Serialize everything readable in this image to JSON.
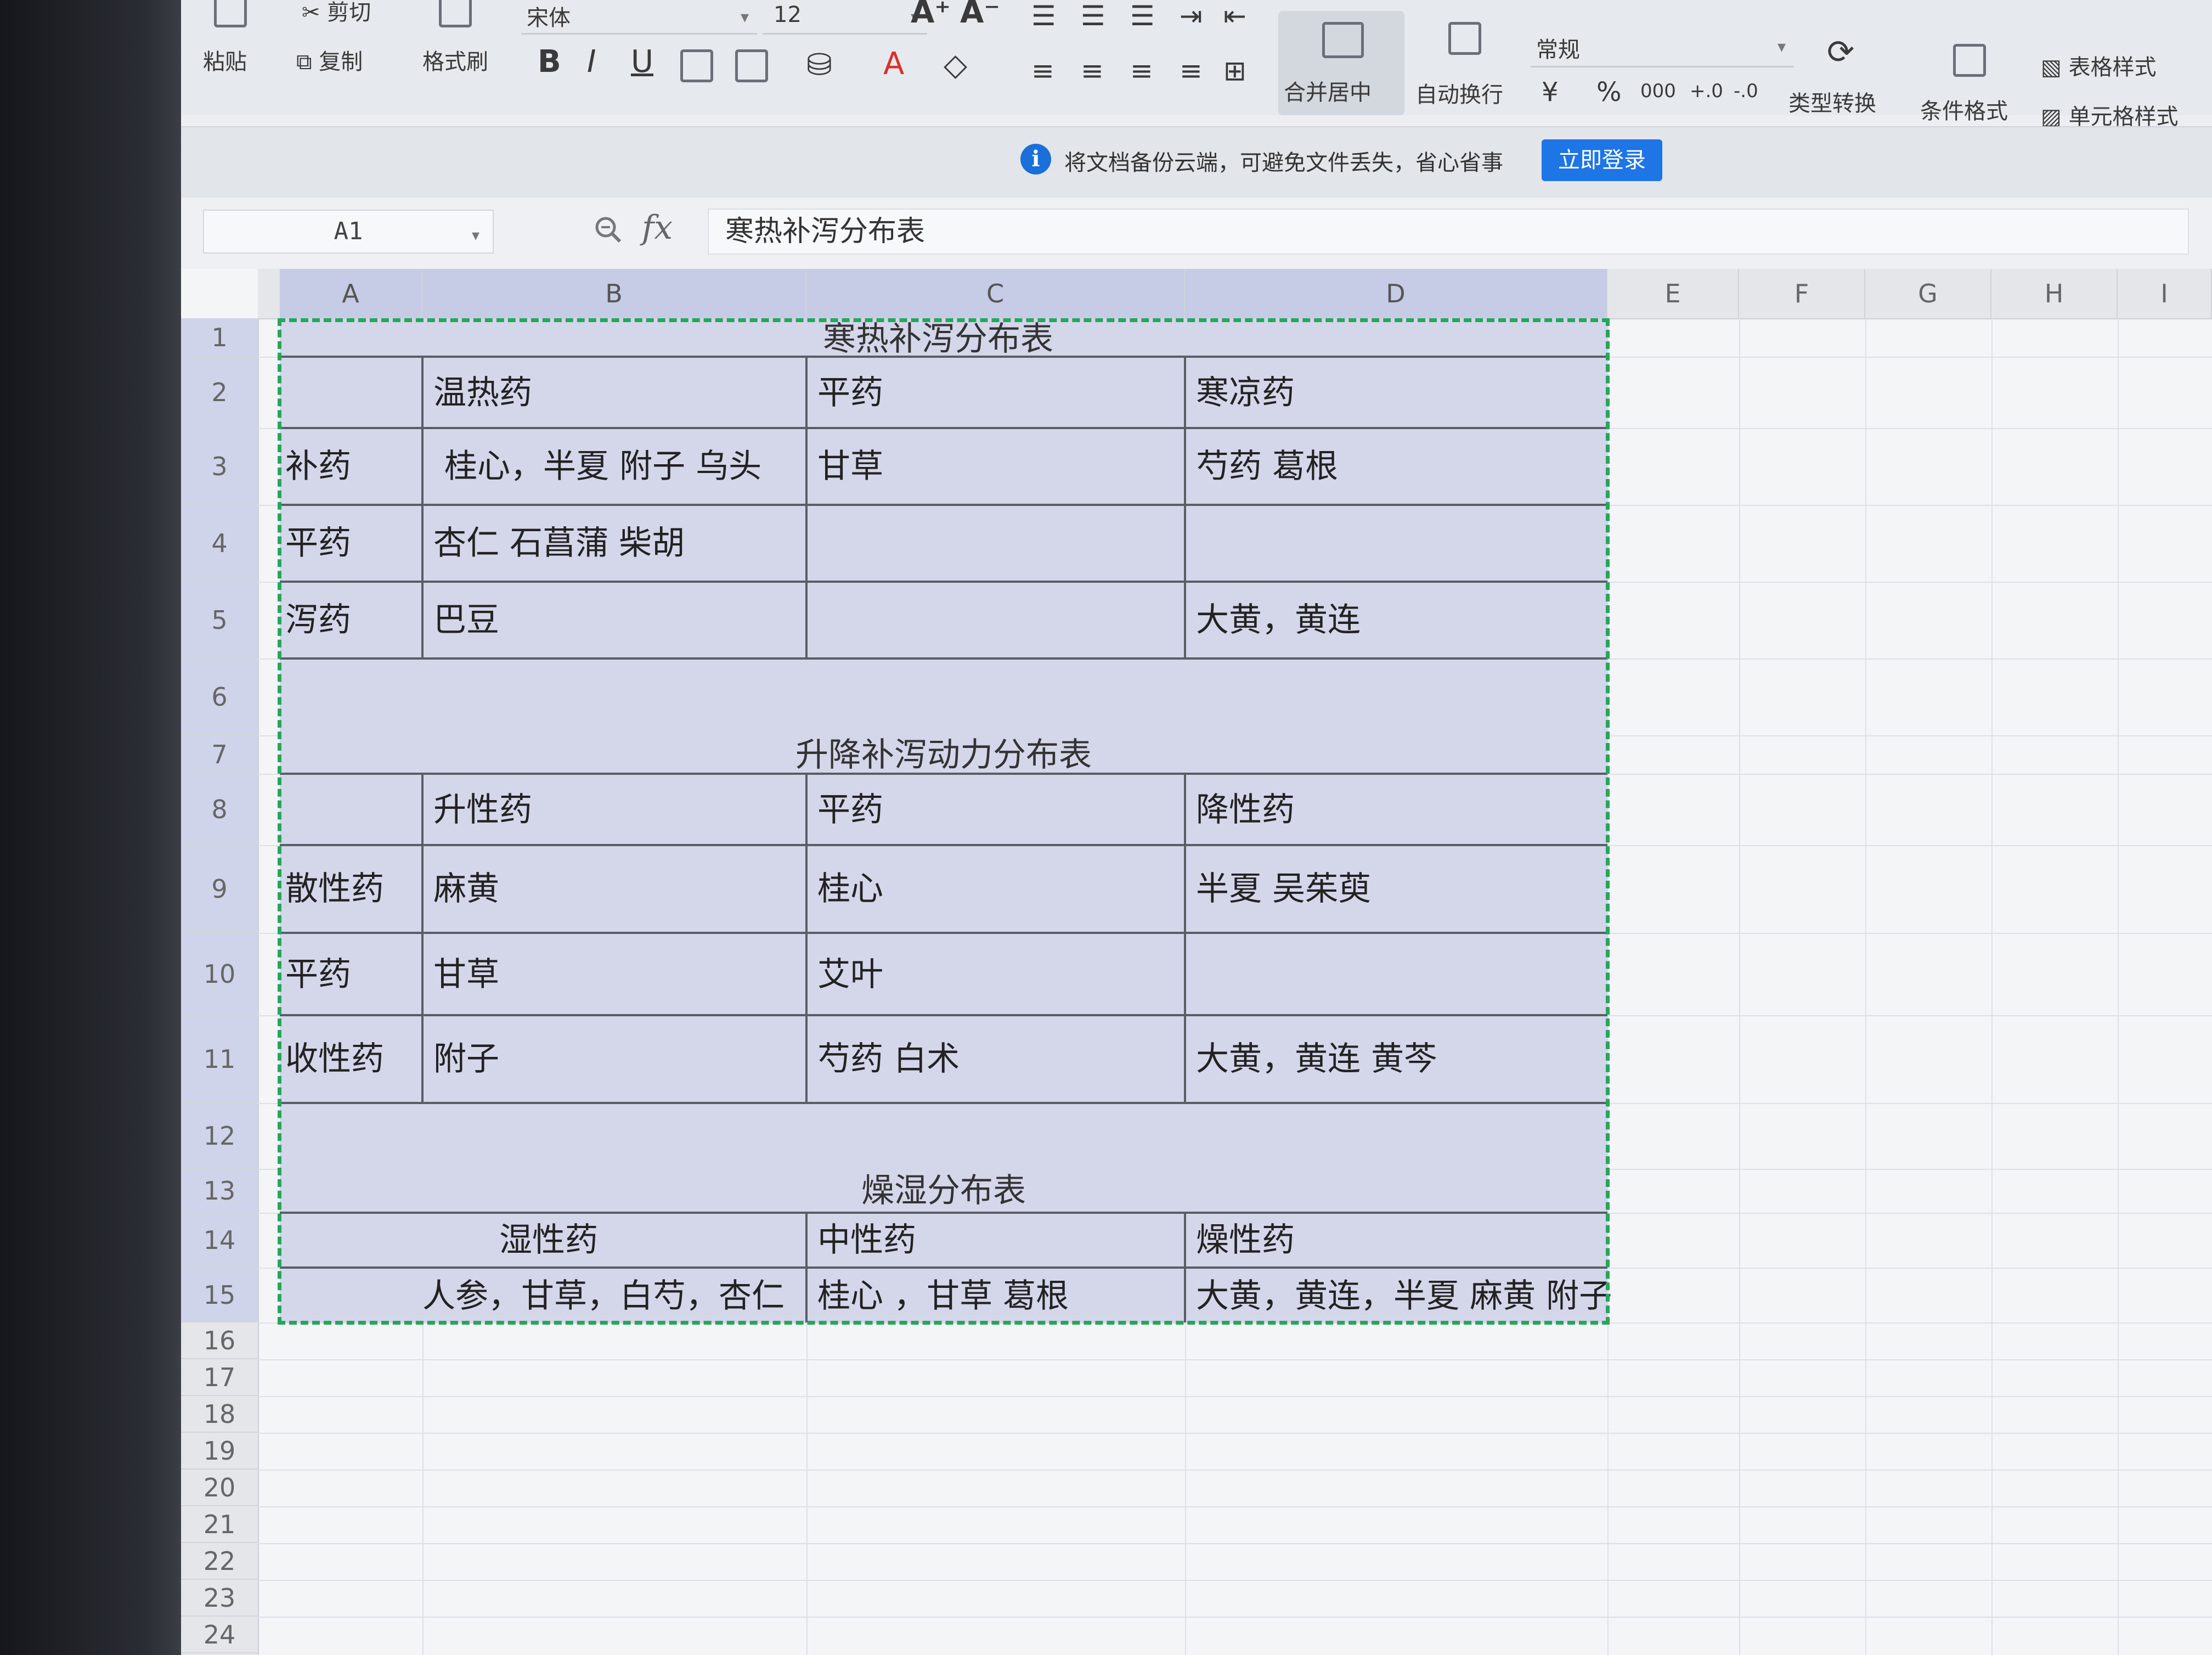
{
  "toolbar": {
    "paste": "粘贴",
    "cut": "剪切",
    "copy": "复制",
    "format_painter": "格式刷",
    "font_name": "宋体",
    "font_size": "12",
    "bold": "B",
    "italic": "I",
    "underline": "U",
    "increase_font": "A⁺",
    "decrease_font": "A⁻",
    "font_color": "A",
    "merge_center": "合并居中",
    "wrap_text": "自动换行",
    "number_format": "常规",
    "currency": "¥",
    "percent": "%",
    "thousands": "000",
    "dec_inc": "+.0",
    "dec_dec": "-.0",
    "type_convert": "类型转换",
    "conditional_format": "条件格式",
    "table_style": "表格样式",
    "cell_style": "单元格样式"
  },
  "notification": {
    "text": "将文档备份云端，可避免文件丢失，省心省事",
    "button": "立即登录"
  },
  "formula_bar": {
    "cell_ref": "A1",
    "fx": "fx",
    "content": "寒热补泻分布表"
  },
  "columns": [
    "A",
    "B",
    "C",
    "D",
    "E",
    "F",
    "G",
    "H",
    "I"
  ],
  "rows": [
    "1",
    "2",
    "3",
    "4",
    "5",
    "6",
    "7",
    "8",
    "9",
    "10",
    "11",
    "12",
    "13",
    "14",
    "15",
    "16",
    "17",
    "18",
    "19",
    "20",
    "21",
    "22",
    "23",
    "24"
  ],
  "table1": {
    "title": "寒热补泻分布表",
    "headers": [
      "温热药",
      "平药",
      "寒凉药"
    ],
    "rows": [
      {
        "label": "补药",
        "cells": [
          "桂心，半夏 附子 乌头",
          "甘草",
          "芍药 葛根"
        ]
      },
      {
        "label": "平药",
        "cells": [
          "杏仁 石菖蒲 柴胡",
          "",
          ""
        ]
      },
      {
        "label": "泻药",
        "cells": [
          "巴豆",
          "",
          "大黄，黄连"
        ]
      }
    ]
  },
  "table2": {
    "title": "升降补泻动力分布表",
    "headers": [
      "升性药",
      "平药",
      "降性药"
    ],
    "rows": [
      {
        "label": "散性药",
        "cells": [
          "麻黄",
          "桂心",
          "半夏 吴茱萸"
        ]
      },
      {
        "label": "平药",
        "cells": [
          "甘草",
          "艾叶",
          ""
        ]
      },
      {
        "label": "收性药",
        "cells": [
          "附子",
          "芍药 白术",
          "大黄，黄连 黄芩"
        ]
      }
    ]
  },
  "table3": {
    "title": "燥湿分布表",
    "headers": [
      "湿性药",
      "中性药",
      "燥性药"
    ],
    "row": [
      "人参，甘草，白芍，杏仁",
      "桂心 ，甘草 葛根",
      "大黄，黄连，半夏 麻黄 附子"
    ]
  }
}
